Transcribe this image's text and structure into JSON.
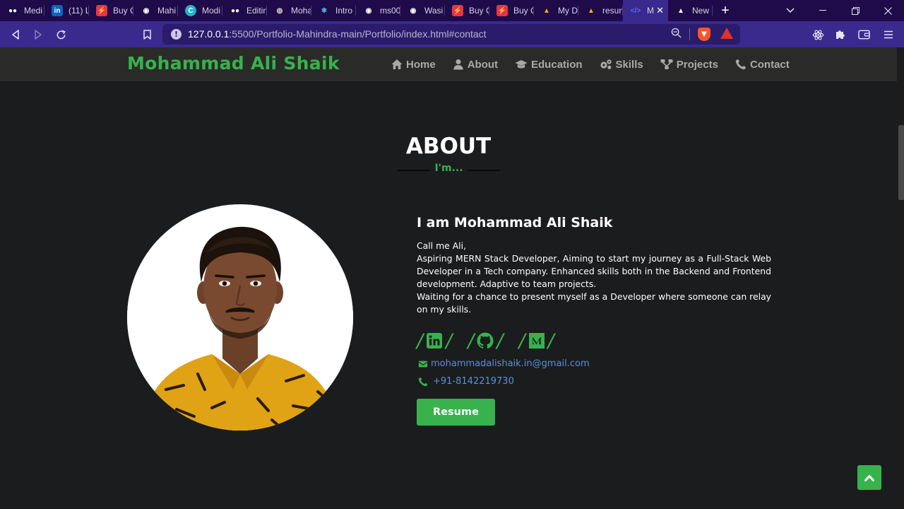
{
  "browser": {
    "tabs": [
      {
        "title": "Medi",
        "icon": "medium-icon",
        "color": "#000000"
      },
      {
        "title": "(11) L",
        "icon": "linkedin-icon",
        "color": "#0a66c2"
      },
      {
        "title": "Buy C",
        "icon": "stripe-red-icon",
        "color": "#e8334a"
      },
      {
        "title": "Mahi",
        "icon": "github-icon",
        "color": "#ffffff"
      },
      {
        "title": "Modi",
        "icon": "canva-icon",
        "color": "#21b2c6"
      },
      {
        "title": "Editin",
        "icon": "medium-icon",
        "color": "#000000"
      },
      {
        "title": "Moha",
        "icon": "globe-icon",
        "color": "#888888"
      },
      {
        "title": "Intro",
        "icon": "react-icon",
        "color": "#61dafb"
      },
      {
        "title": "ms00",
        "icon": "github-icon",
        "color": "#ffffff"
      },
      {
        "title": "Wasi",
        "icon": "github-icon",
        "color": "#ffffff"
      },
      {
        "title": "Buy C",
        "icon": "stripe-red-icon",
        "color": "#e8334a"
      },
      {
        "title": "Buy C",
        "icon": "stripe-red-icon",
        "color": "#e8334a"
      },
      {
        "title": "My D",
        "icon": "drive-icon",
        "color": "#f4b400"
      },
      {
        "title": "resun",
        "icon": "drive-icon",
        "color": "#f4b400"
      },
      {
        "title": "M",
        "icon": "code-icon",
        "color": "#4f6ef7",
        "active": true
      },
      {
        "title": "New",
        "icon": "triangle-icon",
        "color": "#000000"
      }
    ],
    "url": {
      "host": "127.0.0.1",
      "path": ":5500/Portfolio-Mahindra-main/Portfolio/index.html#contact"
    }
  },
  "site": {
    "brand": "Mohammad Ali Shaik",
    "nav": [
      {
        "label": "Home",
        "icon": "home-icon"
      },
      {
        "label": "About",
        "icon": "user-icon"
      },
      {
        "label": "Education",
        "icon": "graduation-cap-icon"
      },
      {
        "label": "Skills",
        "icon": "gears-icon"
      },
      {
        "label": "Projects",
        "icon": "sitemap-icon"
      },
      {
        "label": "Contact",
        "icon": "phone-icon"
      }
    ]
  },
  "about": {
    "title": "ABOUT",
    "subtitle": "I'm...",
    "heading": "I am Mohammad Ali Shaik",
    "paragraphs": [
      "Call me Ali,",
      "Aspiring MERN Stack Developer, Aiming to start my journey as a Full-Stack Web Developer in a Tech company. Enhanced skills both in the Backend and Frontend development. Adaptive to team projects.",
      "Waiting for a chance to present myself as a Developer where someone can relay on my skills."
    ],
    "socials": [
      {
        "name": "linkedin",
        "icon": "linkedin-icon"
      },
      {
        "name": "github",
        "icon": "github-icon"
      },
      {
        "name": "medium",
        "icon": "medium-icon"
      }
    ],
    "email": "mohammadalishaik.in@gmail.com",
    "phone": "+91-8142219730",
    "resume_label": "Resume"
  },
  "colors": {
    "accent": "#37b24d",
    "background": "#1b1c1e",
    "navbar": "#2a2b28",
    "link": "#5b8fd8",
    "browser_tabbar": "#1f0a4a",
    "browser_toolbar": "#3a2a8e"
  }
}
